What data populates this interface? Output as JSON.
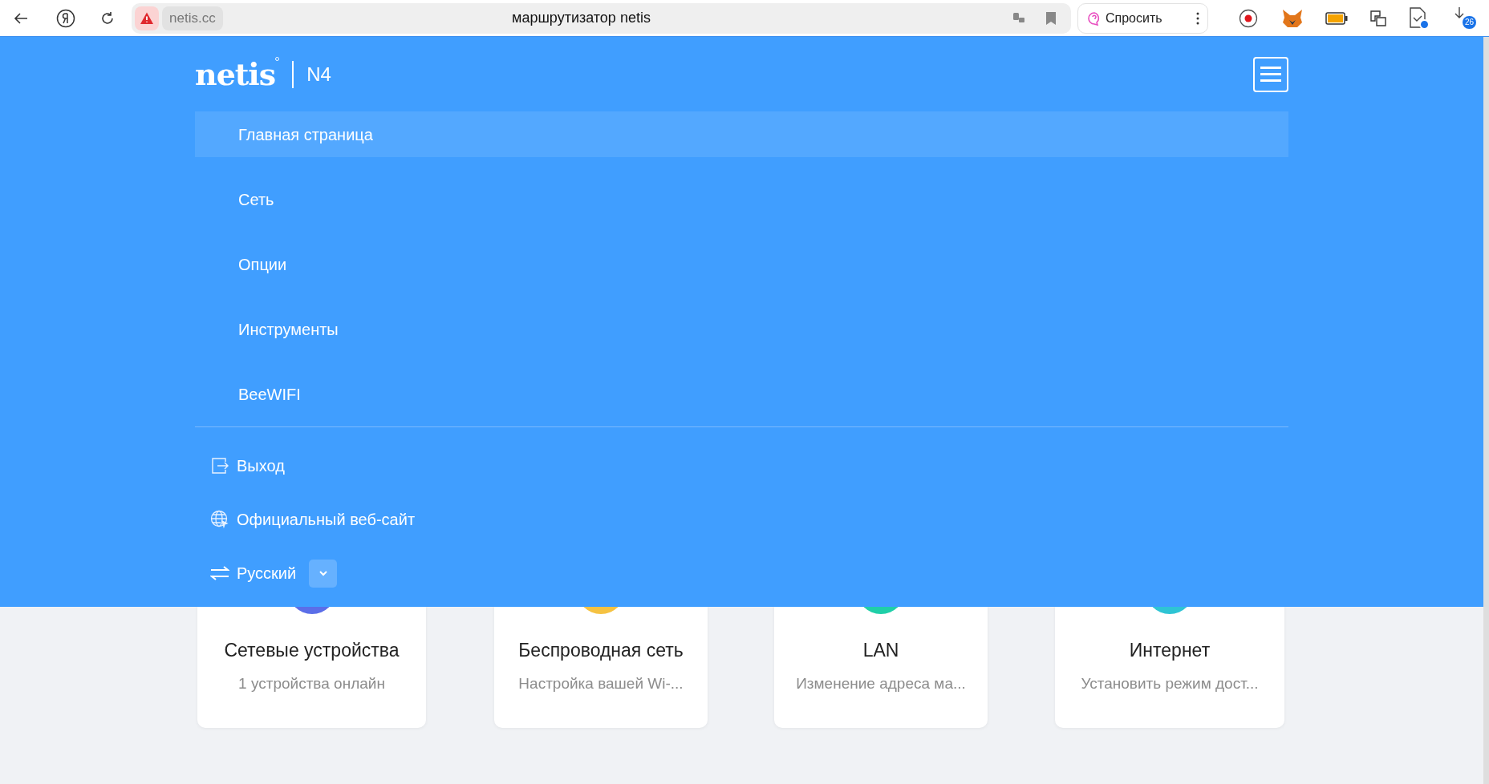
{
  "browser": {
    "url": "netis.cc",
    "title": "маршрутизатор netis",
    "ask_button": "Спросить",
    "downloads_count": "26"
  },
  "header": {
    "logo": "netis",
    "model": "N4"
  },
  "menu": [
    {
      "label": "Главная страница",
      "selected": true
    },
    {
      "label": "Сеть",
      "selected": false
    },
    {
      "label": "Опции",
      "selected": false
    },
    {
      "label": "Инструменты",
      "selected": false
    },
    {
      "label": "BeeWIFI",
      "selected": false
    }
  ],
  "footer_items": [
    {
      "kind": "exit",
      "label": "Выход"
    },
    {
      "kind": "website",
      "label": "Официальный веб-сайт"
    },
    {
      "kind": "language",
      "label": "Русский"
    }
  ],
  "cards": [
    {
      "title": "Сетевые устройства",
      "subtitle": "1 устройства онлайн",
      "color": "#5b6ee8"
    },
    {
      "title": "Беспроводная сеть",
      "subtitle": "Настройка вашей Wi-...",
      "color": "#f5c242"
    },
    {
      "title": "LAN",
      "subtitle": "Изменение адреса ма...",
      "color": "#1fcfa8"
    },
    {
      "title": "Интернет",
      "subtitle": "Установить режим дост...",
      "color": "#2ec4d4"
    }
  ]
}
